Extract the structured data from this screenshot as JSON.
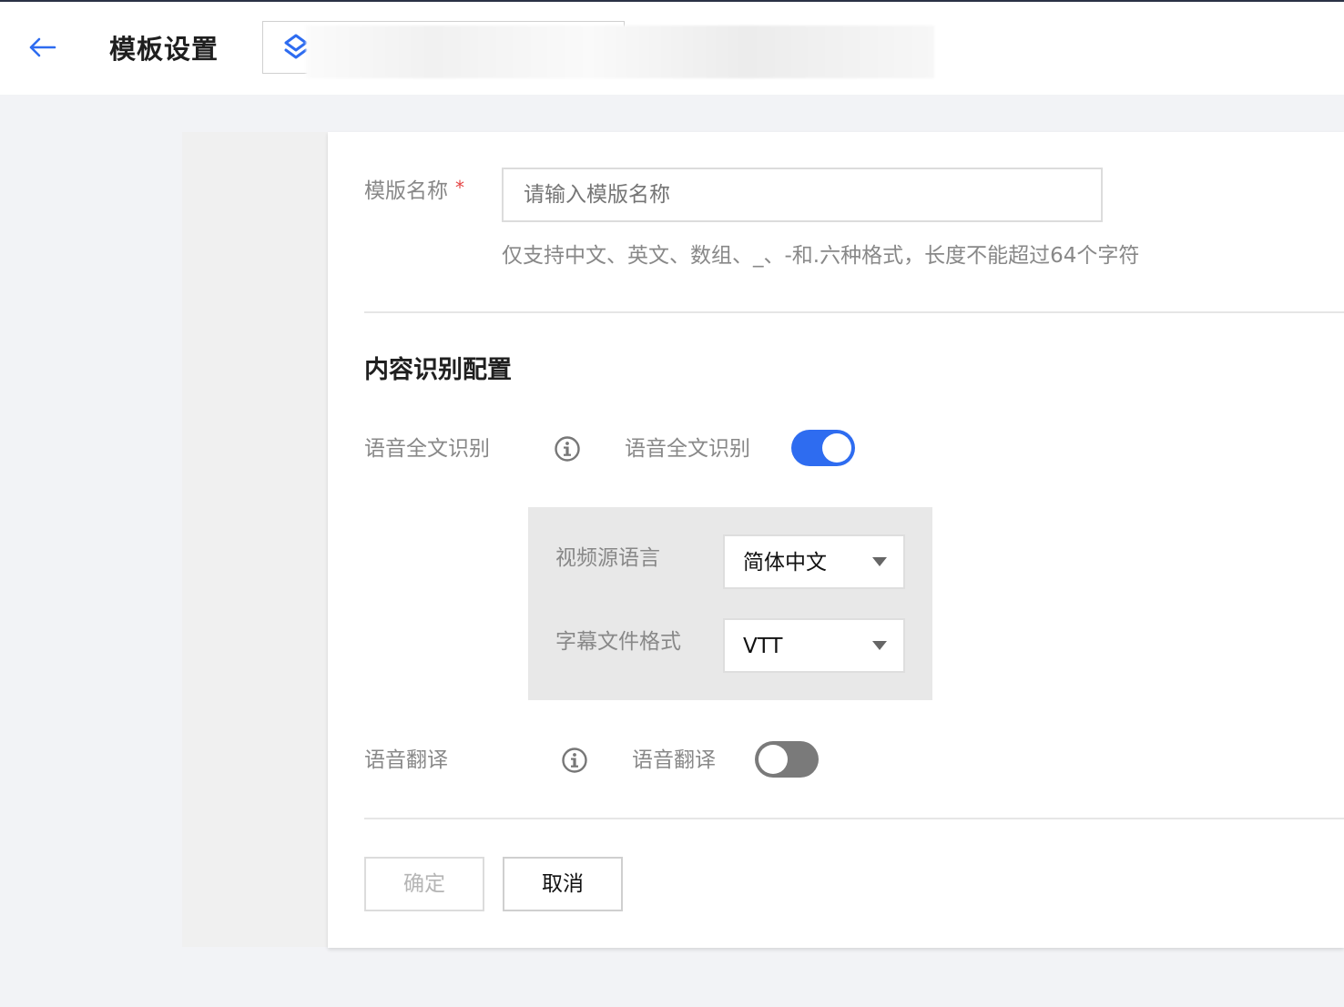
{
  "header": {
    "title": "模板设置",
    "back_icon": "arrow-left-icon",
    "app_selector_icon": "layers-icon",
    "accent_color": "#2e6cf0"
  },
  "form": {
    "name_label": "模版名称",
    "required_mark": "*",
    "name_placeholder": "请输入模版名称",
    "name_hint": "仅支持中文、英文、数组、_、-和.六种格式，长度不能超过64个字符"
  },
  "content_recognition": {
    "section_title": "内容识别配置",
    "speech_recognition": {
      "label": "语音全文识别",
      "toggle_label": "语音全文识别",
      "enabled": true,
      "source_language_label": "视频源语言",
      "source_language_value": "简体中文",
      "subtitle_format_label": "字幕文件格式",
      "subtitle_format_value": "VTT"
    },
    "speech_translation": {
      "label": "语音翻译",
      "toggle_label": "语音翻译",
      "enabled": false
    }
  },
  "actions": {
    "confirm_label": "确定",
    "cancel_label": "取消"
  }
}
